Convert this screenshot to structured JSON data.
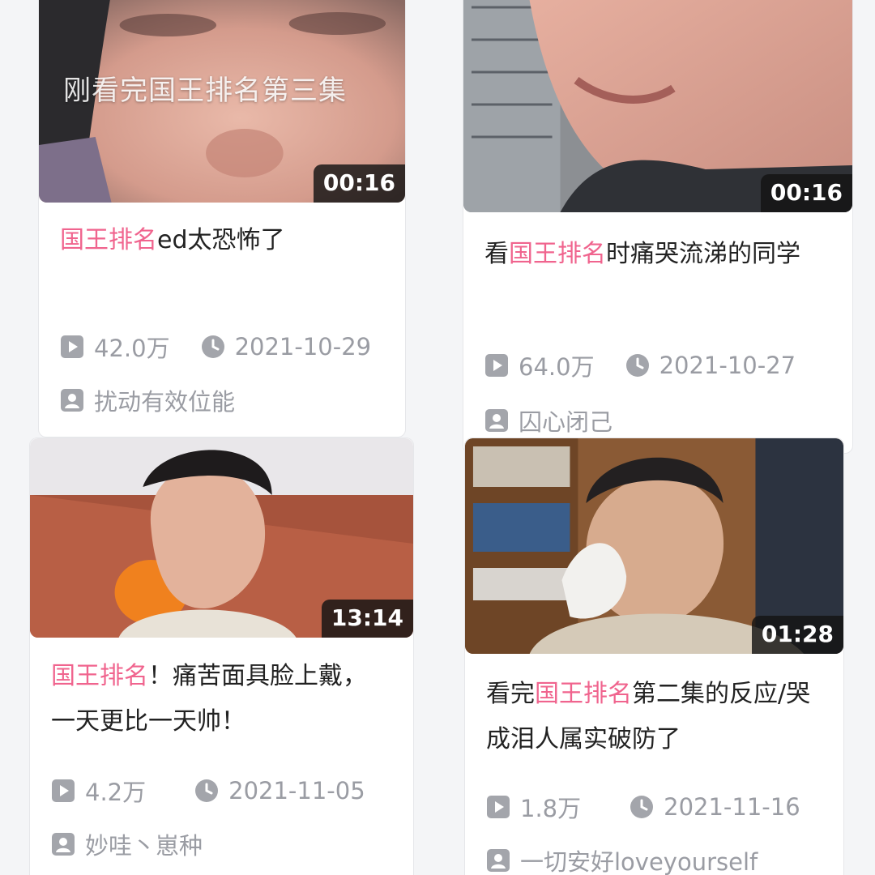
{
  "colors": {
    "highlight": "#f0648e",
    "meta_gray": "#9a9ca3",
    "title_text": "#222222"
  },
  "icons": {
    "views": "play-box-icon",
    "date": "clock-icon",
    "author": "person-box-icon"
  },
  "cards": [
    {
      "overlay_text": "刚看完国王排名第三集",
      "duration": "00:16",
      "title": {
        "before": "",
        "highlight": "国王排名",
        "after": "ed太恐怖了"
      },
      "views": "42.0万",
      "date": "2021-10-29",
      "author": "扰动有效位能"
    },
    {
      "duration": "00:16",
      "title": {
        "before": "看",
        "highlight": "国王排名",
        "after": "时痛哭流涕的同学"
      },
      "views": "64.0万",
      "date": "2021-10-27",
      "author": "囚心闭己"
    },
    {
      "duration": "13:14",
      "title": {
        "before": "",
        "highlight": "国王排名",
        "after": "！痛苦面具脸上戴，一天更比一天帅！"
      },
      "views": "4.2万",
      "date": "2021-11-05",
      "author": "妙哇丶崽种"
    },
    {
      "duration": "01:28",
      "title": {
        "before": "看完",
        "highlight": "国王排名",
        "after": "第二集的反应/哭成泪人属实破防了"
      },
      "views": "1.8万",
      "date": "2021-11-16",
      "author": "一切安好loveyourself"
    }
  ]
}
